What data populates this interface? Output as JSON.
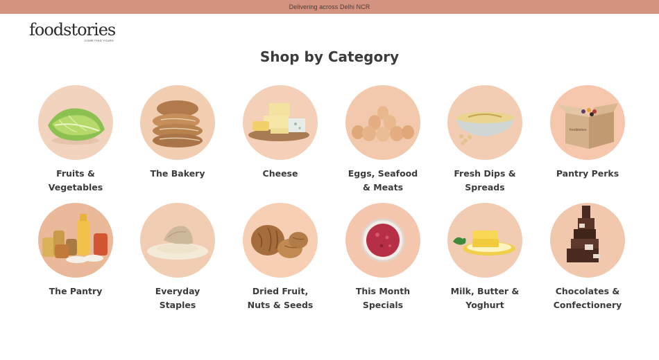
{
  "announcement": {
    "text": "Delivering across Delhi NCR"
  },
  "brand": {
    "logo_text": "foodstories",
    "tagline": "COME FIND YOURS"
  },
  "section": {
    "title": "Shop by Category"
  },
  "categories": [
    {
      "label": "Fruits &\nVegetables",
      "icon": "lettuce-icon",
      "bg": "#f2d3bd"
    },
    {
      "label": "The Bakery",
      "icon": "bread-icon",
      "bg": "#f1cdb2"
    },
    {
      "label": "Cheese",
      "icon": "cheese-icon",
      "bg": "#f3d0b7"
    },
    {
      "label": "Eggs, Seafood\n& Meats",
      "icon": "eggs-icon",
      "bg": "#f2c9ad"
    },
    {
      "label": "Fresh Dips &\nSpreads",
      "icon": "dip-bowl-icon",
      "bg": "#f2cdb4"
    },
    {
      "label": "Pantry Perks",
      "icon": "box-icon",
      "bg": "#f6c6ad"
    },
    {
      "label": "The Pantry",
      "icon": "jars-icon",
      "bg": "#e9b99a"
    },
    {
      "label": "Everyday\nStaples",
      "icon": "flour-sack-icon",
      "bg": "#f1cdb3"
    },
    {
      "label": "Dried Fruit,\nNuts & Seeds",
      "icon": "walnut-icon",
      "bg": "#f7cfb4"
    },
    {
      "label": "This Month\nSpecials",
      "icon": "jam-jar-icon",
      "bg": "#f3c6ad"
    },
    {
      "label": "Milk, Butter &\nYoghurt",
      "icon": "butter-icon",
      "bg": "#f2cbb3"
    },
    {
      "label": "Chocolates &\nConfectionery",
      "icon": "chocolate-icon",
      "bg": "#f1c7ae"
    }
  ]
}
